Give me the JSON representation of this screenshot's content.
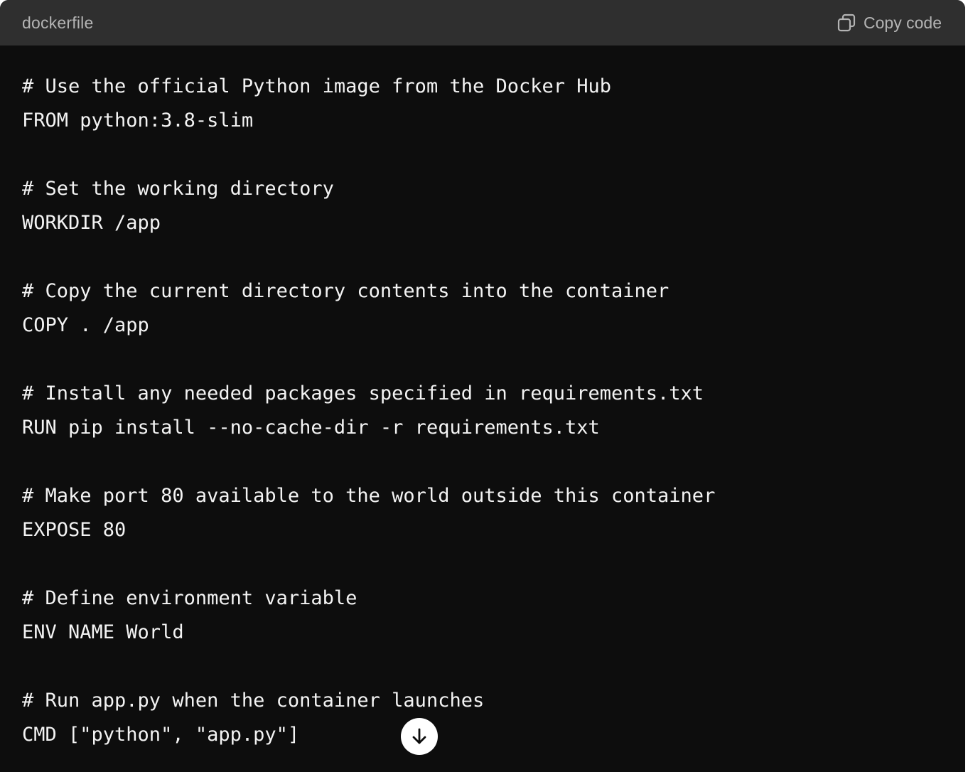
{
  "header": {
    "language": "dockerfile",
    "copy_label": "Copy code",
    "copy_icon": "copy-icon"
  },
  "code": {
    "lines": [
      "# Use the official Python image from the Docker Hub",
      "FROM python:3.8-slim",
      "",
      "# Set the working directory",
      "WORKDIR /app",
      "",
      "# Copy the current directory contents into the container",
      "COPY . /app",
      "",
      "# Install any needed packages specified in requirements.txt",
      "RUN pip install --no-cache-dir -r requirements.txt",
      "",
      "# Make port 80 available to the world outside this container",
      "EXPOSE 80",
      "",
      "# Define environment variable",
      "ENV NAME World",
      "",
      "# Run app.py when the container launches",
      "CMD [\"python\", \"app.py\"]"
    ]
  },
  "scroll_button": {
    "icon": "arrow-down-icon"
  },
  "colors": {
    "code_background": "#0d0d0d",
    "header_background": "#2f2f2f",
    "code_text": "#f3f3f3",
    "header_text": "#b4b4b4"
  }
}
